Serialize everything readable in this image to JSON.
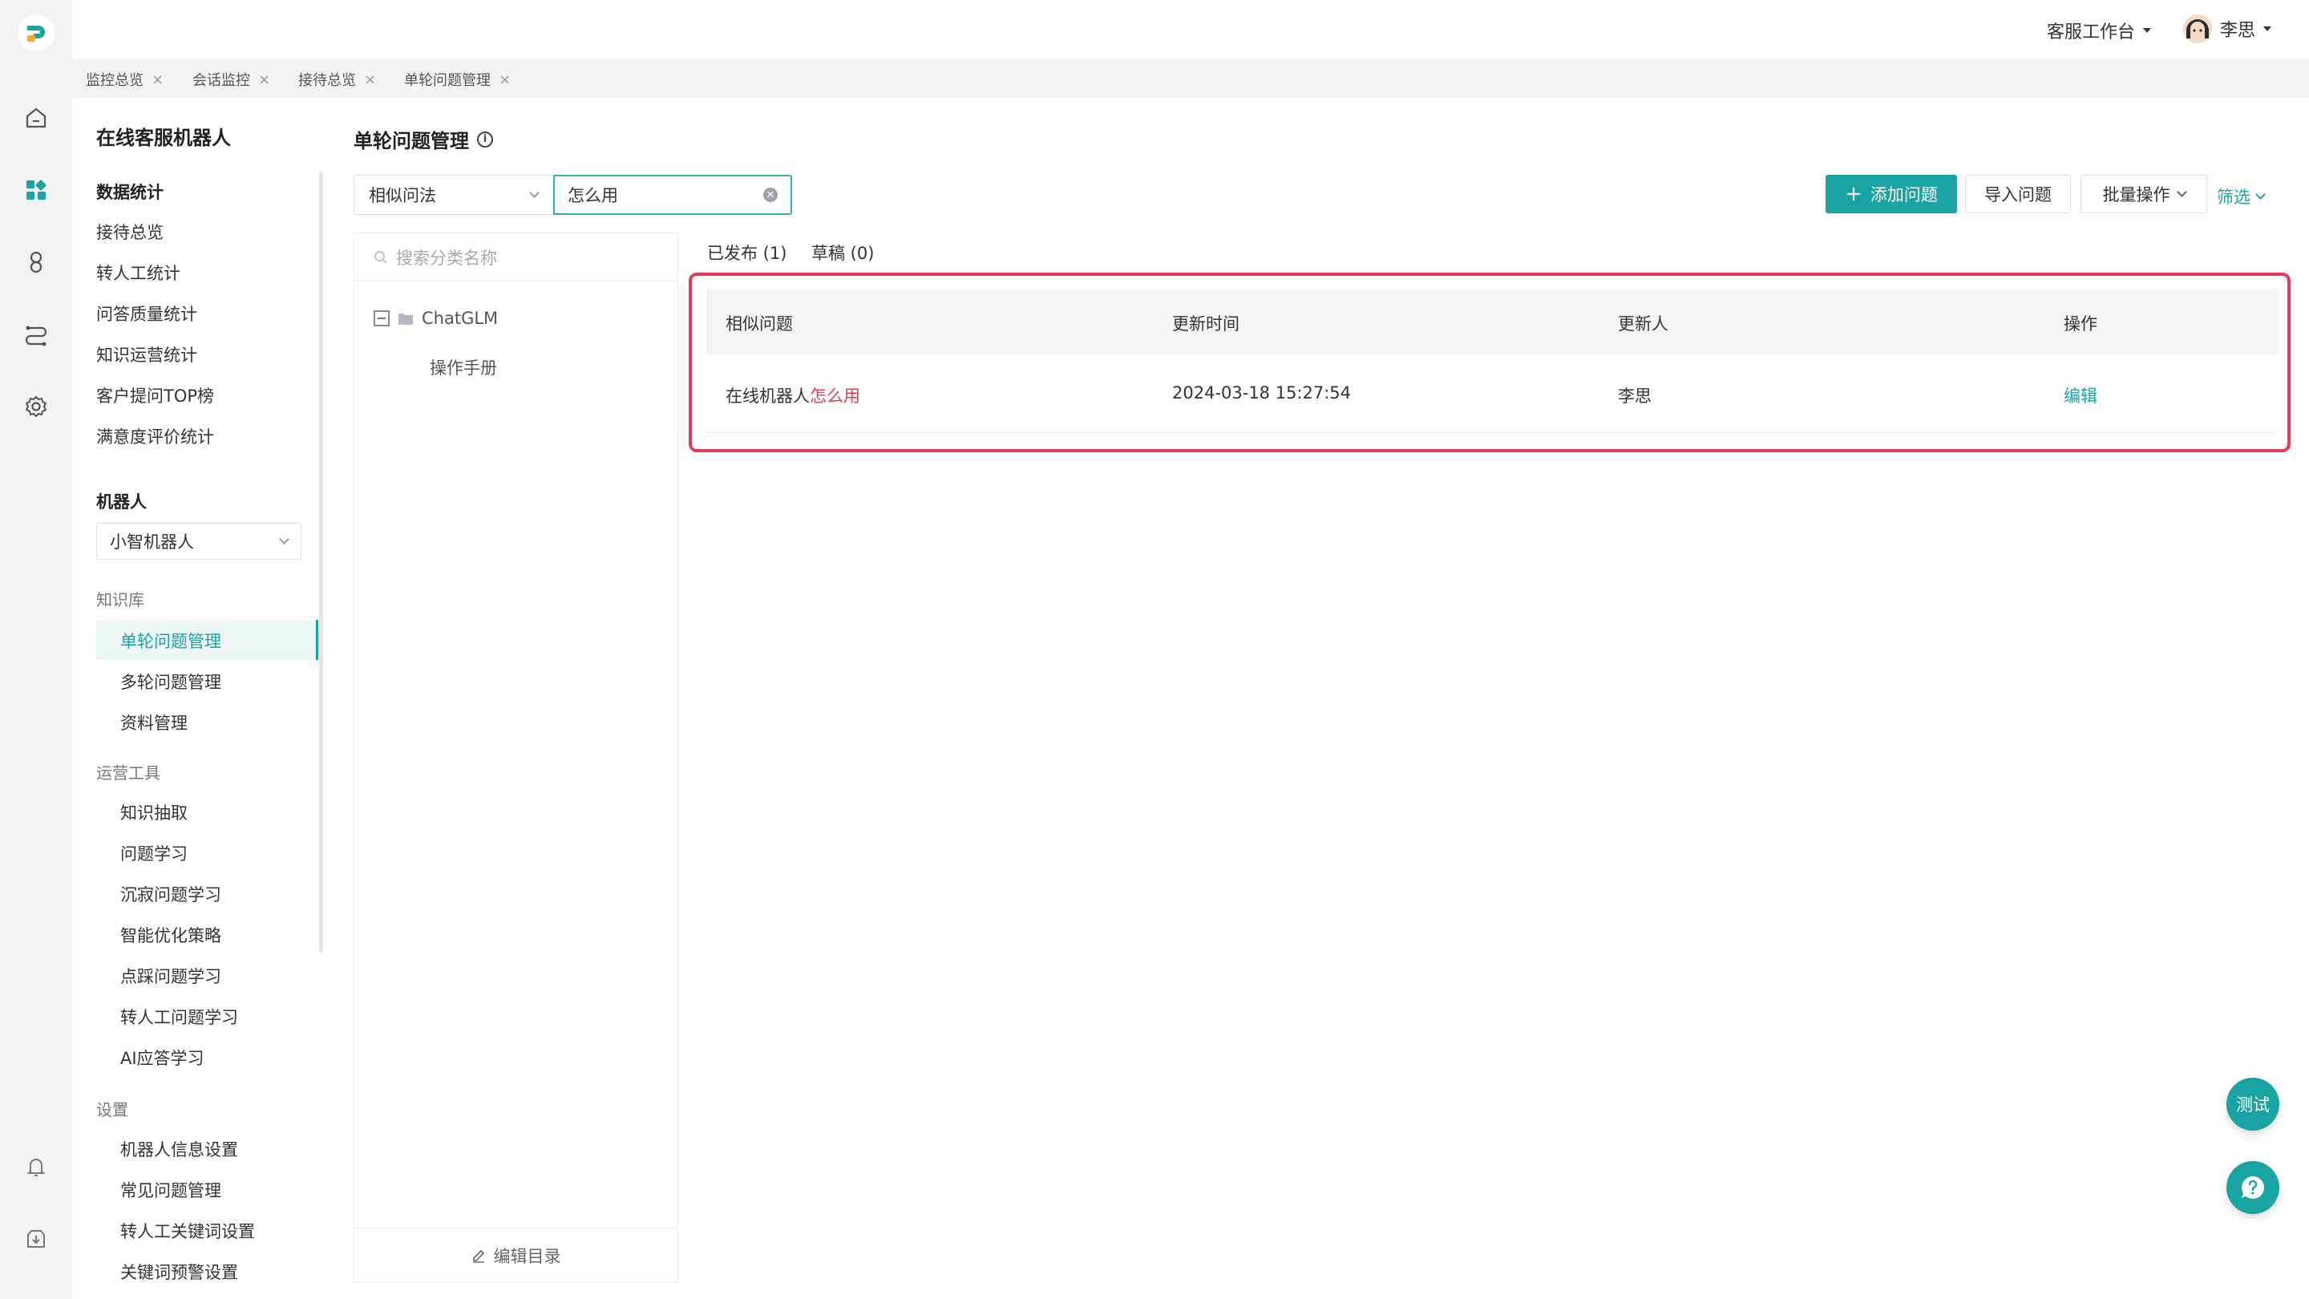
{
  "colors": {
    "accent": "#1aa3a3",
    "highlight": "#e6395b"
  },
  "header": {
    "workspace": "客服工作台",
    "user_name": "李思"
  },
  "tabs": [
    {
      "label": "监控总览",
      "close": "×"
    },
    {
      "label": "会话监控",
      "close": "×"
    },
    {
      "label": "接待总览",
      "close": "×"
    },
    {
      "label": "单轮问题管理",
      "close": "×"
    }
  ],
  "sidebar": {
    "title": "在线客服机器人",
    "stats_section": "数据统计",
    "stats_items": [
      "接待总览",
      "转人工统计",
      "问答质量统计",
      "知识运营统计",
      "客户提问TOP榜",
      "满意度评价统计"
    ],
    "robot_section": "机器人",
    "robot_selected": "小智机器人",
    "kb_group": "知识库",
    "kb_items": [
      "单轮问题管理",
      "多轮问题管理",
      "资料管理"
    ],
    "ops_group": "运营工具",
    "ops_items": [
      "知识抽取",
      "问题学习",
      "沉寂问题学习",
      "智能优化策略",
      "点踩问题学习",
      "转人工问题学习",
      "AI应答学习"
    ],
    "settings_group": "设置",
    "settings_items": [
      "机器人信息设置",
      "常见问题管理",
      "转人工关键词设置",
      "关键词预警设置"
    ]
  },
  "main": {
    "title": "单轮问题管理",
    "filter_field": "相似问法",
    "search_value": "怎么用",
    "add_button": "添加问题",
    "import_button": "导入问题",
    "batch_button": "批量操作",
    "filter_link": "筛选",
    "tree": {
      "search_placeholder": "搜索分类名称",
      "root": "ChatGLM",
      "child": "操作手册",
      "footer": "编辑目录"
    },
    "list_tabs": [
      {
        "label": "已发布 (1)"
      },
      {
        "label": "草稿 (0)"
      }
    ],
    "table": {
      "headers": [
        "相似问题",
        "更新时间",
        "更新人",
        "操作"
      ],
      "rows": [
        {
          "question_prefix": "在线机器人",
          "question_match": "怎么用",
          "updated_at": "2024-03-18 15:27:54",
          "updated_by": "李思",
          "action": "编辑"
        }
      ]
    },
    "test_button": "测试"
  }
}
